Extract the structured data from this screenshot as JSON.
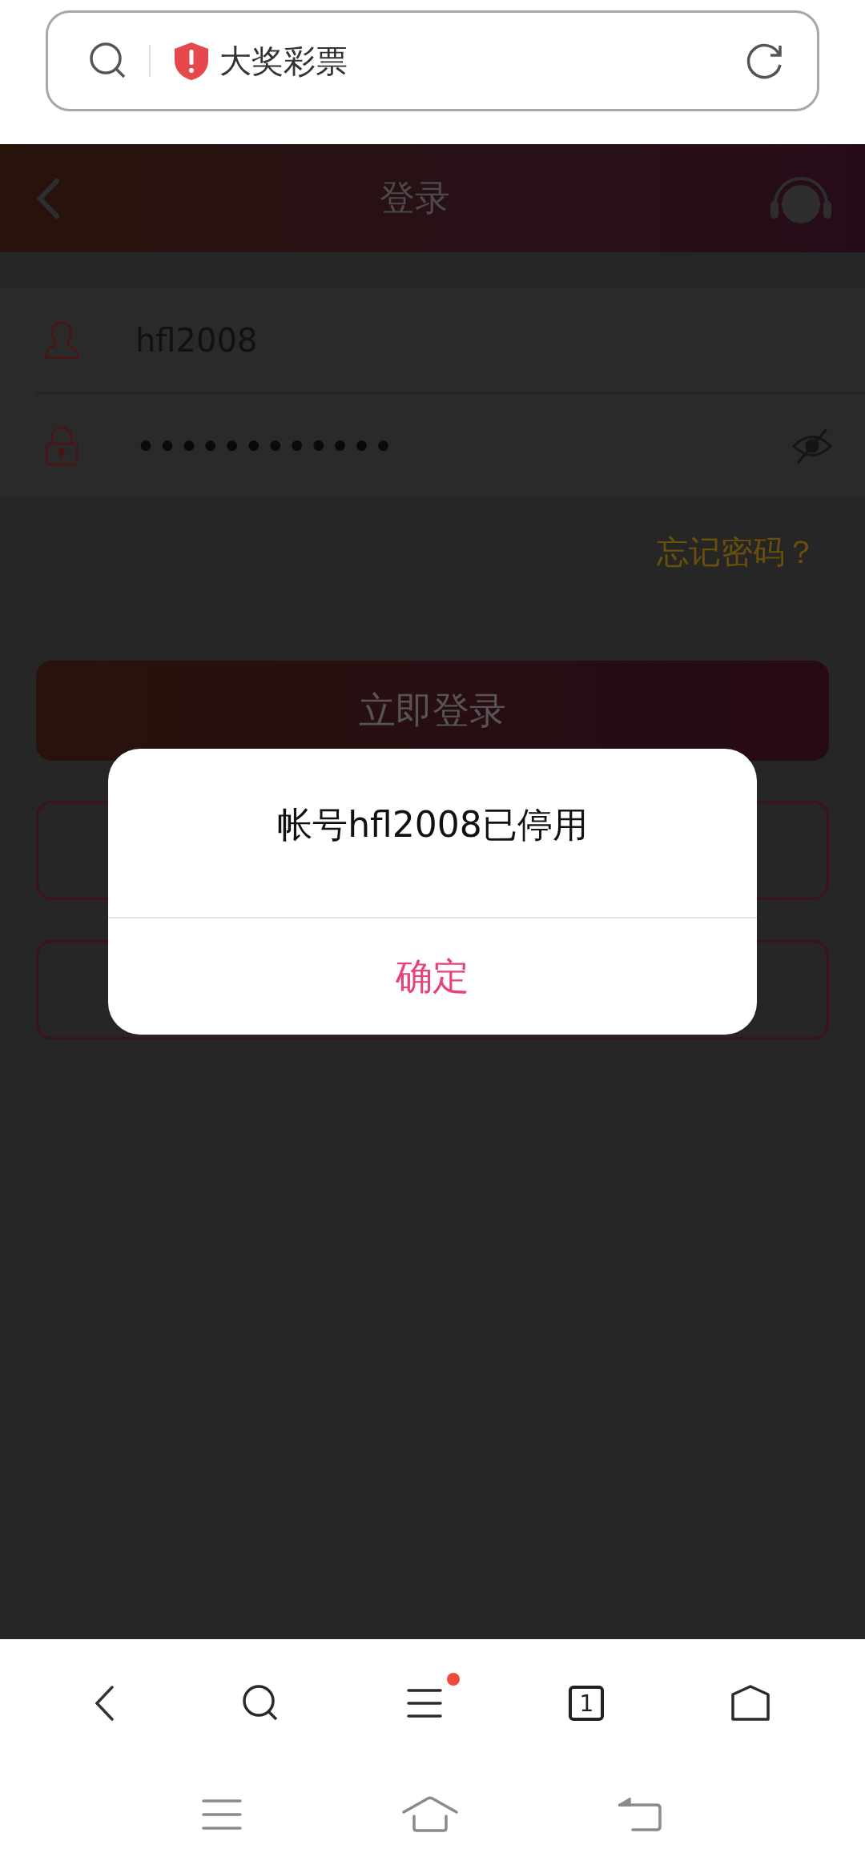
{
  "browser_bar": {
    "site_title": "大奖彩票"
  },
  "header": {
    "title": "登录"
  },
  "login_form": {
    "username": "hfl2008",
    "password": "••••••••••••",
    "password_visible": false,
    "forgot_link": "忘记密码？",
    "login_button": "立即登录"
  },
  "outline_buttons": [
    {
      "kind": "outline"
    },
    {
      "kind": "outline"
    }
  ],
  "dialog": {
    "message": "帐号hfl2008已停用",
    "confirm_button": "确定"
  },
  "browser_toolbar": {
    "tab_count": "1",
    "menu_badge": true
  }
}
